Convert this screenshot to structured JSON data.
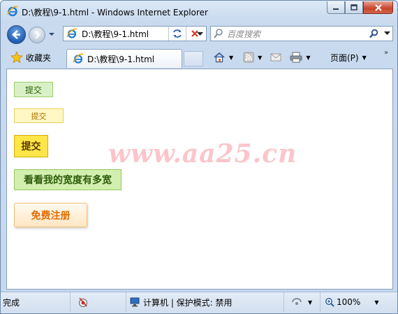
{
  "window": {
    "title": "D:\\教程\\9-1.html - Windows Internet Explorer"
  },
  "navbar": {
    "address": "D:\\教程\\9-1.html",
    "search_placeholder": "百度搜索"
  },
  "cmdbar": {
    "favorites_label": "收藏夹",
    "tab_label": "D:\\教程\\9-1.html",
    "page_menu_label": "页面(P)"
  },
  "content": {
    "buttons": [
      {
        "label": "提交"
      },
      {
        "label": "提交"
      },
      {
        "label": "提交"
      },
      {
        "label": "看看我的宽度有多宽"
      },
      {
        "label": "免费注册"
      }
    ],
    "watermark": "www.aa25.cn"
  },
  "statusbar": {
    "status_text": "完成",
    "zone_text": "计算机 | 保护模式: 禁用",
    "zoom_text": "100%"
  },
  "colors": {
    "window_frame": "#c9daef",
    "button1_bg": "#d9f0c6",
    "button2_bg": "#fff7c4",
    "button3_bg": "#ffe648",
    "button4_bg": "#d2efb0",
    "button5_text": "#e06b00",
    "watermark": "#f896a0"
  }
}
